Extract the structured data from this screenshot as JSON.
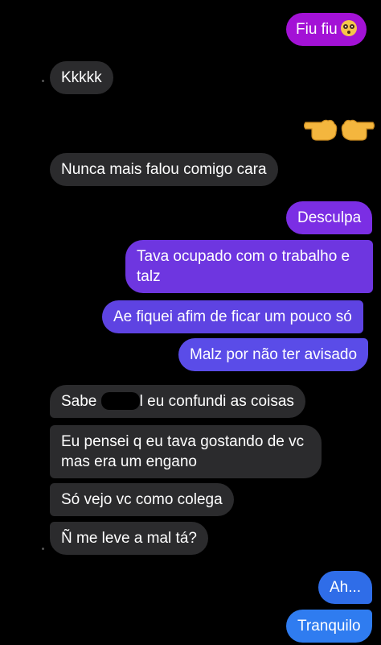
{
  "conversation": {
    "messages": [
      {
        "id": "m1",
        "side": "sent",
        "text": "Fiu fiu",
        "emoji": "flushed-face-emoji"
      },
      {
        "id": "m2",
        "side": "received",
        "text": "Kkkkk"
      },
      {
        "id": "m3",
        "side": "sent",
        "type": "emoji",
        "emoji": "pointing-hands-emoji"
      },
      {
        "id": "m4",
        "side": "received",
        "text": "Nunca mais falou comigo cara"
      },
      {
        "id": "m5",
        "side": "sent",
        "text": "Desculpa"
      },
      {
        "id": "m6",
        "side": "sent",
        "text": "Tava ocupado com o trabalho e talz"
      },
      {
        "id": "m7",
        "side": "sent",
        "text": "Ae fiquei afim de ficar um pouco só"
      },
      {
        "id": "m8",
        "side": "sent",
        "text": "Malz por não ter avisado"
      },
      {
        "id": "m9",
        "side": "received",
        "text_before": "Sabe",
        "text_after": "l eu confundi as coisas",
        "redacted": true
      },
      {
        "id": "m10",
        "side": "received",
        "text": "Eu pensei q eu tava gostando de vc mas era um engano"
      },
      {
        "id": "m11",
        "side": "received",
        "text": "Só vejo vc como colega"
      },
      {
        "id": "m12",
        "side": "received",
        "text": "Ñ me leve a mal tá?"
      },
      {
        "id": "m13",
        "side": "sent",
        "text": "Ah..."
      },
      {
        "id": "m14",
        "side": "sent",
        "text": "Tranquilo"
      }
    ]
  },
  "colors": {
    "background": "#000000",
    "received_bubble": "#2b2b2d",
    "sent_purple": "#9b1fe0",
    "sent_violet": "#6a39e0",
    "sent_blue": "#2f74f0"
  }
}
